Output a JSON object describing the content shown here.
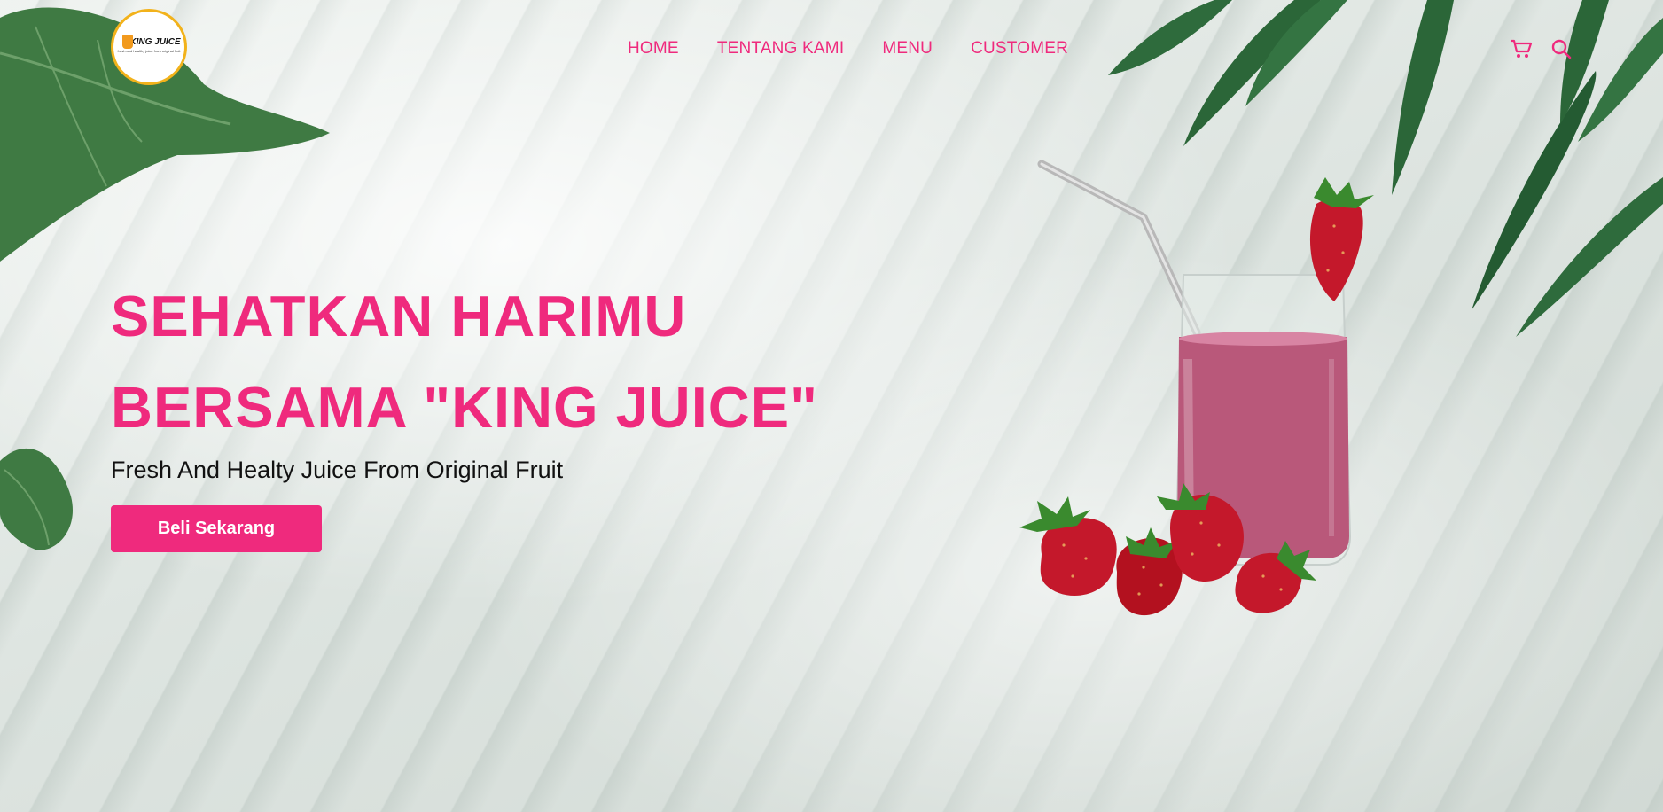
{
  "brand": {
    "name": "KING JUICE",
    "tagline": "fresh and healthy juice from original fruit"
  },
  "nav": {
    "items": [
      "HOME",
      "TENTANG KAMI",
      "MENU",
      "CUSTOMER"
    ]
  },
  "header_icons": [
    "cart-icon",
    "search-icon"
  ],
  "hero": {
    "title_line1": "SEHATKAN HARIMU",
    "title_line2": "BERSAMA \"KING JUICE\"",
    "subtitle": "Fresh And Healty Juice From Original Fruit",
    "cta_label": "Beli Sekarang"
  },
  "colors": {
    "accent": "#ef2a7d",
    "background": "#dfe5e1",
    "leaf": "#2f6b3a",
    "juice": "#b9587a",
    "strawberry": "#c4182b"
  }
}
